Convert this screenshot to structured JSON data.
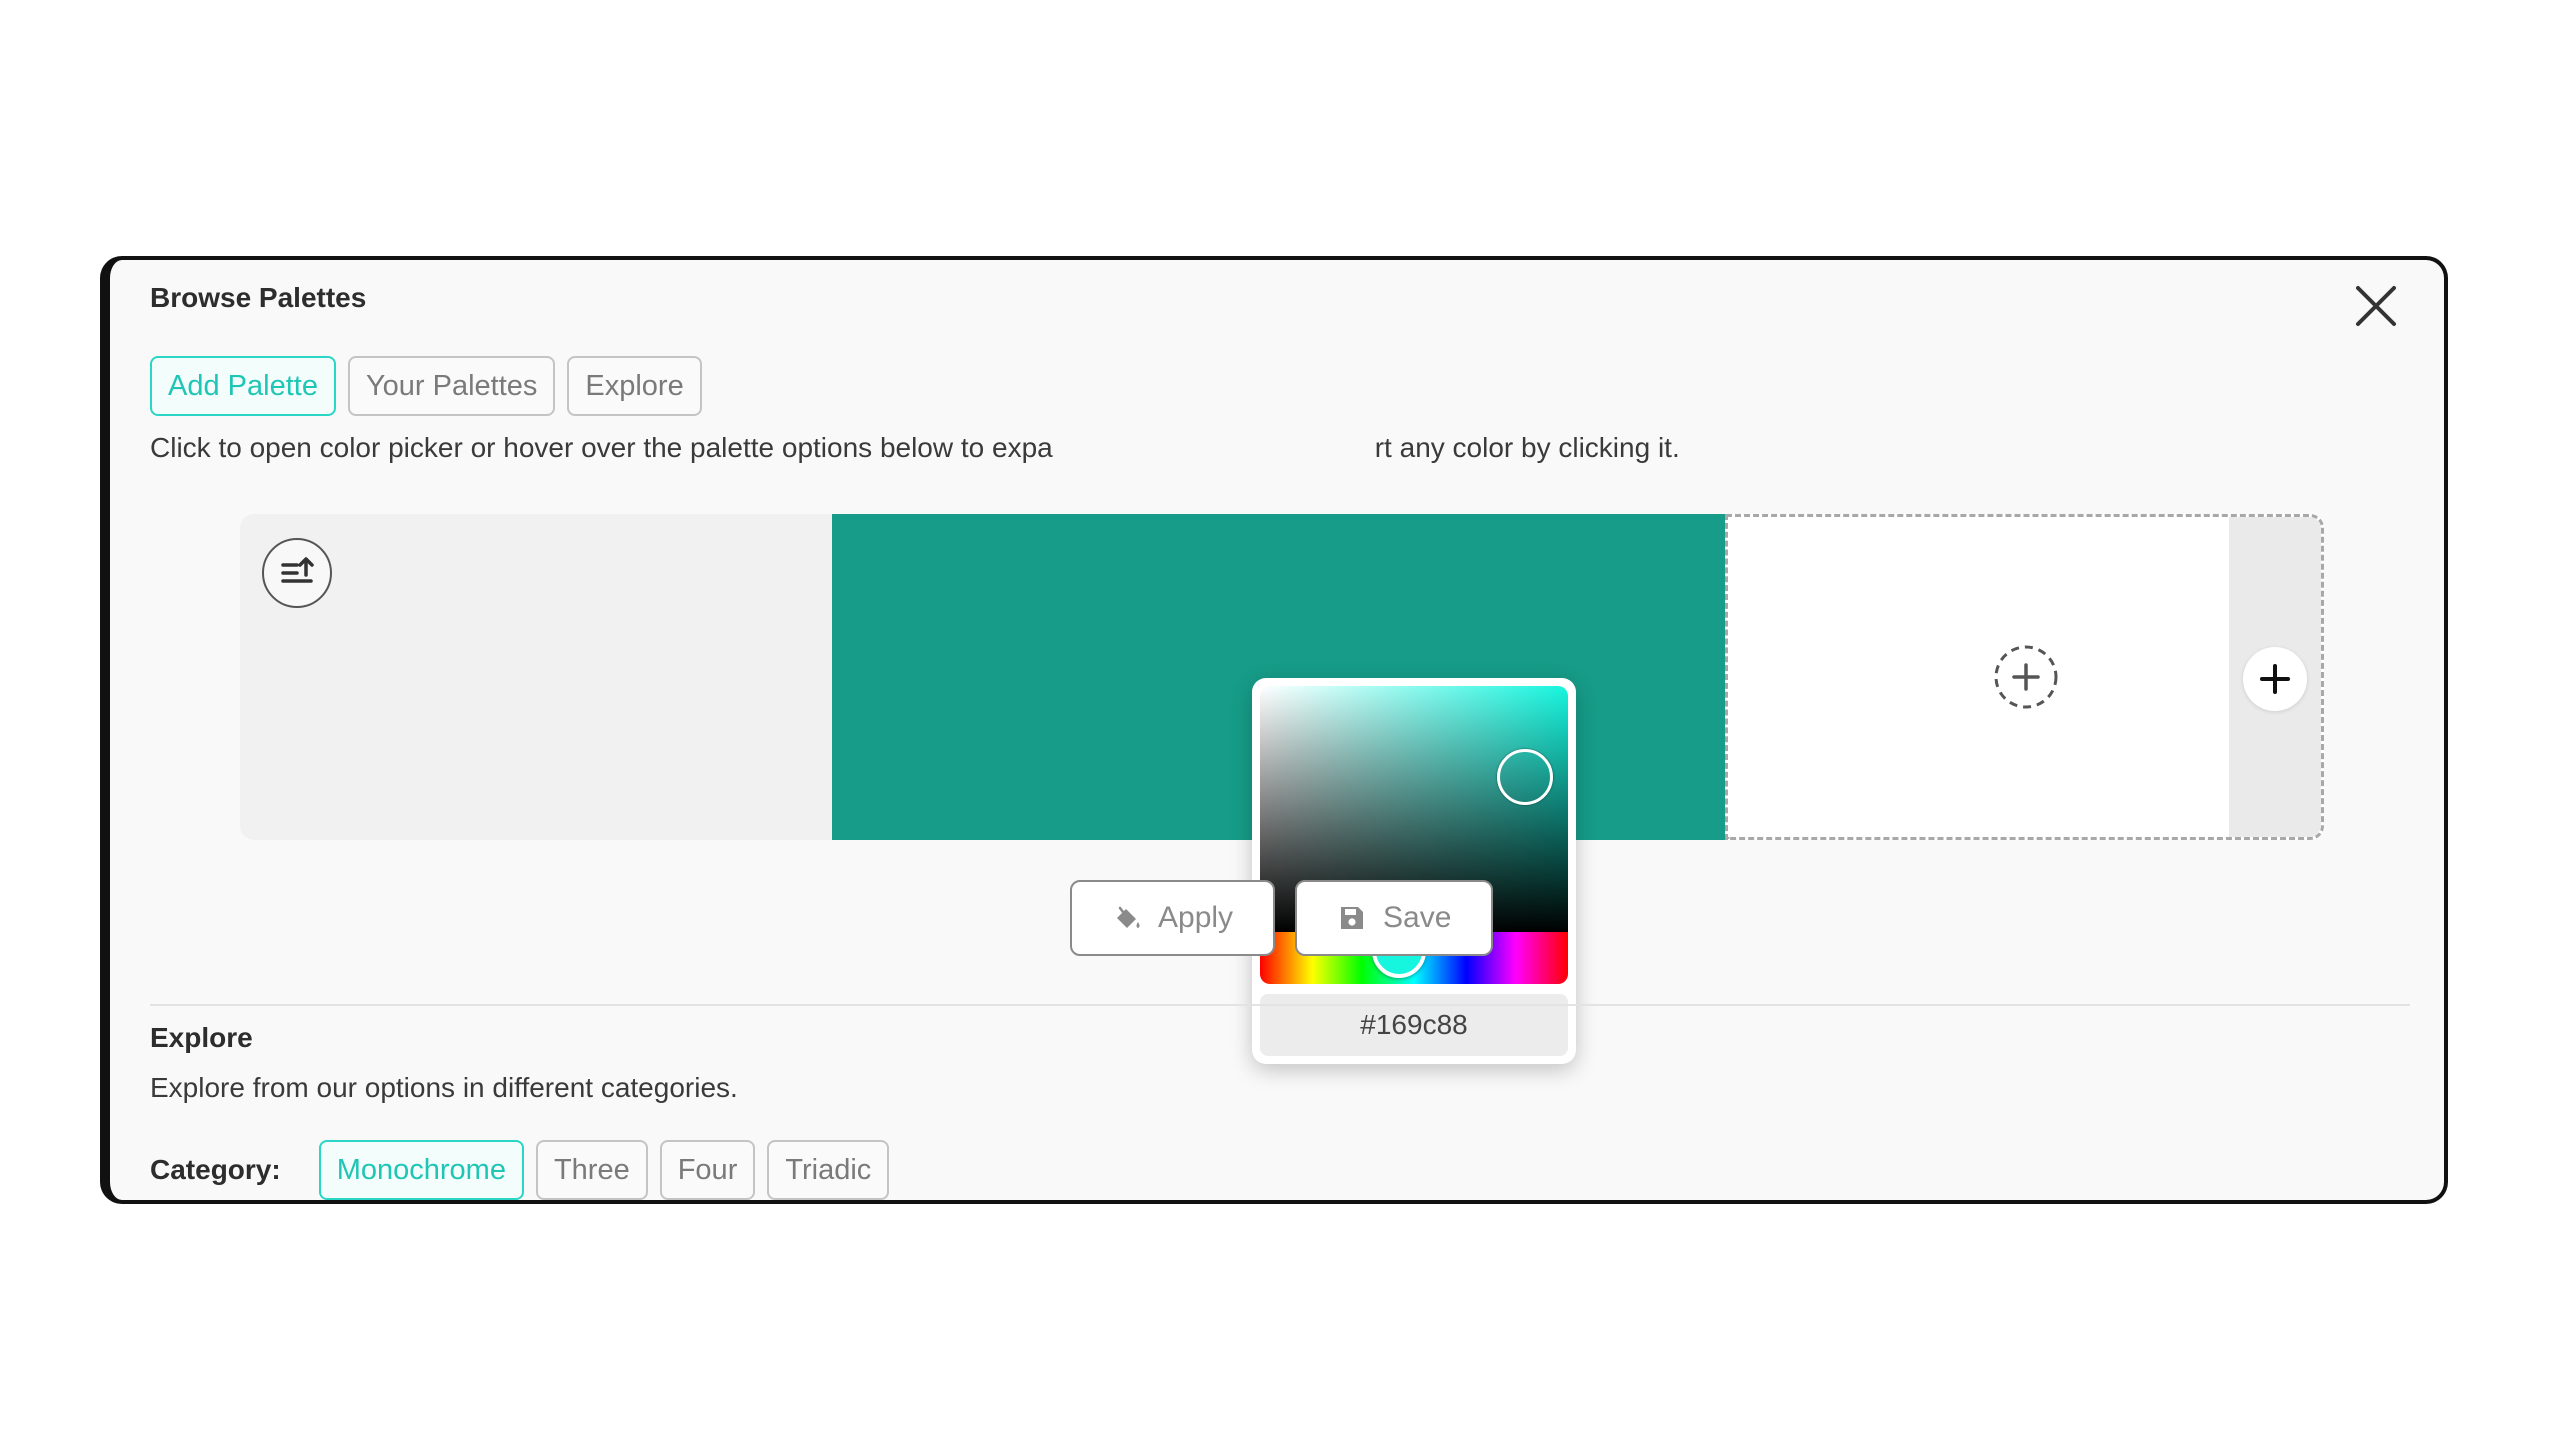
{
  "modal": {
    "title": "Browse Palettes",
    "close_icon": "close-icon"
  },
  "tabs": [
    {
      "label": "Add Palette",
      "active": true
    },
    {
      "label": "Your Palettes",
      "active": false
    },
    {
      "label": "Explore",
      "active": false
    }
  ],
  "instructions": {
    "left": "Click to open color picker or hover over the palette options below to expa",
    "right": "rt any color by clicking it."
  },
  "palette": {
    "sort_icon": "sort-ascending-icon",
    "swatch_color": "#169c88",
    "add_slot_icon": "dashed-plus-circle-icon",
    "add_icon": "plus-icon"
  },
  "color_picker": {
    "hex_value": "#169c88",
    "hue_color": "#16f5de"
  },
  "actions": {
    "apply_label": "Apply",
    "apply_icon": "paint-bucket-icon",
    "save_label": "Save",
    "save_icon": "floppy-disk-icon"
  },
  "explore": {
    "title": "Explore",
    "description": "Explore from our options in different categories.",
    "category_label": "Category:",
    "categories": [
      {
        "label": "Monochrome",
        "active": true
      },
      {
        "label": "Three",
        "active": false
      },
      {
        "label": "Four",
        "active": false
      },
      {
        "label": "Triadic",
        "active": false
      }
    ]
  },
  "colors": {
    "accent": "#1fc6b5",
    "swatch": "#169c88"
  }
}
